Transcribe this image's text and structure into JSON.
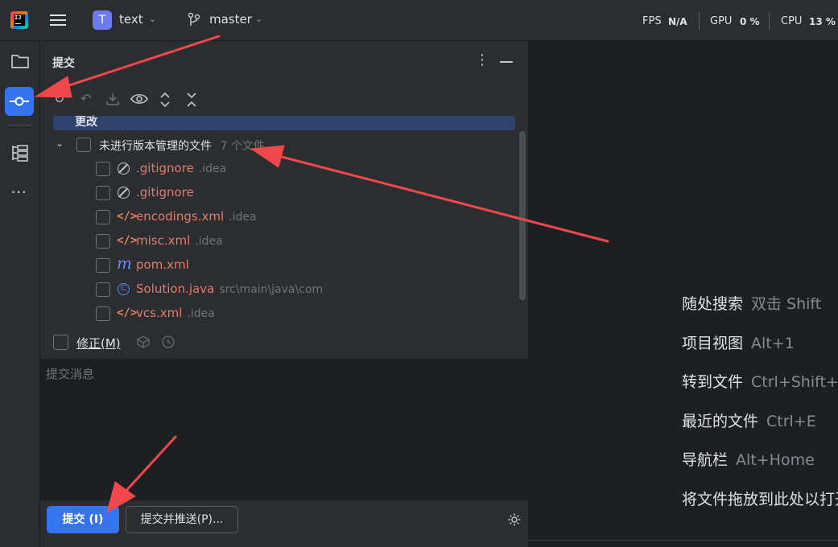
{
  "titlebar": {
    "project_letter": "T",
    "project_name": "text",
    "branch": "master",
    "stats": {
      "fps_label": "FPS",
      "fps_value": "N/A",
      "gpu_label": "GPU",
      "gpu_value": "0 %",
      "cpu_label": "CPU",
      "cpu_value": "13 %"
    }
  },
  "commit_panel": {
    "title": "提交",
    "changes_label": "更改",
    "unversioned": {
      "label": "未进行版本管理的文件",
      "count": "7 个文件"
    },
    "files": [
      {
        "name": ".gitignore",
        "path": ".idea",
        "icon": "ignore-icon"
      },
      {
        "name": ".gitignore",
        "path": "",
        "icon": "ignore-icon"
      },
      {
        "name": "encodings.xml",
        "path": ".idea",
        "icon": "xml-icon"
      },
      {
        "name": "misc.xml",
        "path": ".idea",
        "icon": "xml-icon"
      },
      {
        "name": "pom.xml",
        "path": "",
        "icon": "maven-icon"
      },
      {
        "name": "Solution.java",
        "path": "src\\main\\java\\com",
        "icon": "java-class-icon"
      },
      {
        "name": "vcs.xml",
        "path": ".idea",
        "icon": "xml-icon"
      }
    ],
    "amend_label": "修正(M)",
    "message_placeholder": "提交消息",
    "commit_button": "提交 (I)",
    "commit_push_button": "提交并推送(P)..."
  },
  "editor_hints": [
    {
      "action": "随处搜索",
      "shortcut": "双击 Shift"
    },
    {
      "action": "项目视图",
      "shortcut": "Alt+1"
    },
    {
      "action": "转到文件",
      "shortcut": "Ctrl+Shift+N"
    },
    {
      "action": "最近的文件",
      "shortcut": "Ctrl+E"
    },
    {
      "action": "导航栏",
      "shortcut": "Alt+Home"
    },
    {
      "action": "将文件拖放到此处以打开",
      "shortcut": ""
    }
  ],
  "colors": {
    "accent": "#3574f0",
    "annotation_arrow": "#f0484a"
  }
}
